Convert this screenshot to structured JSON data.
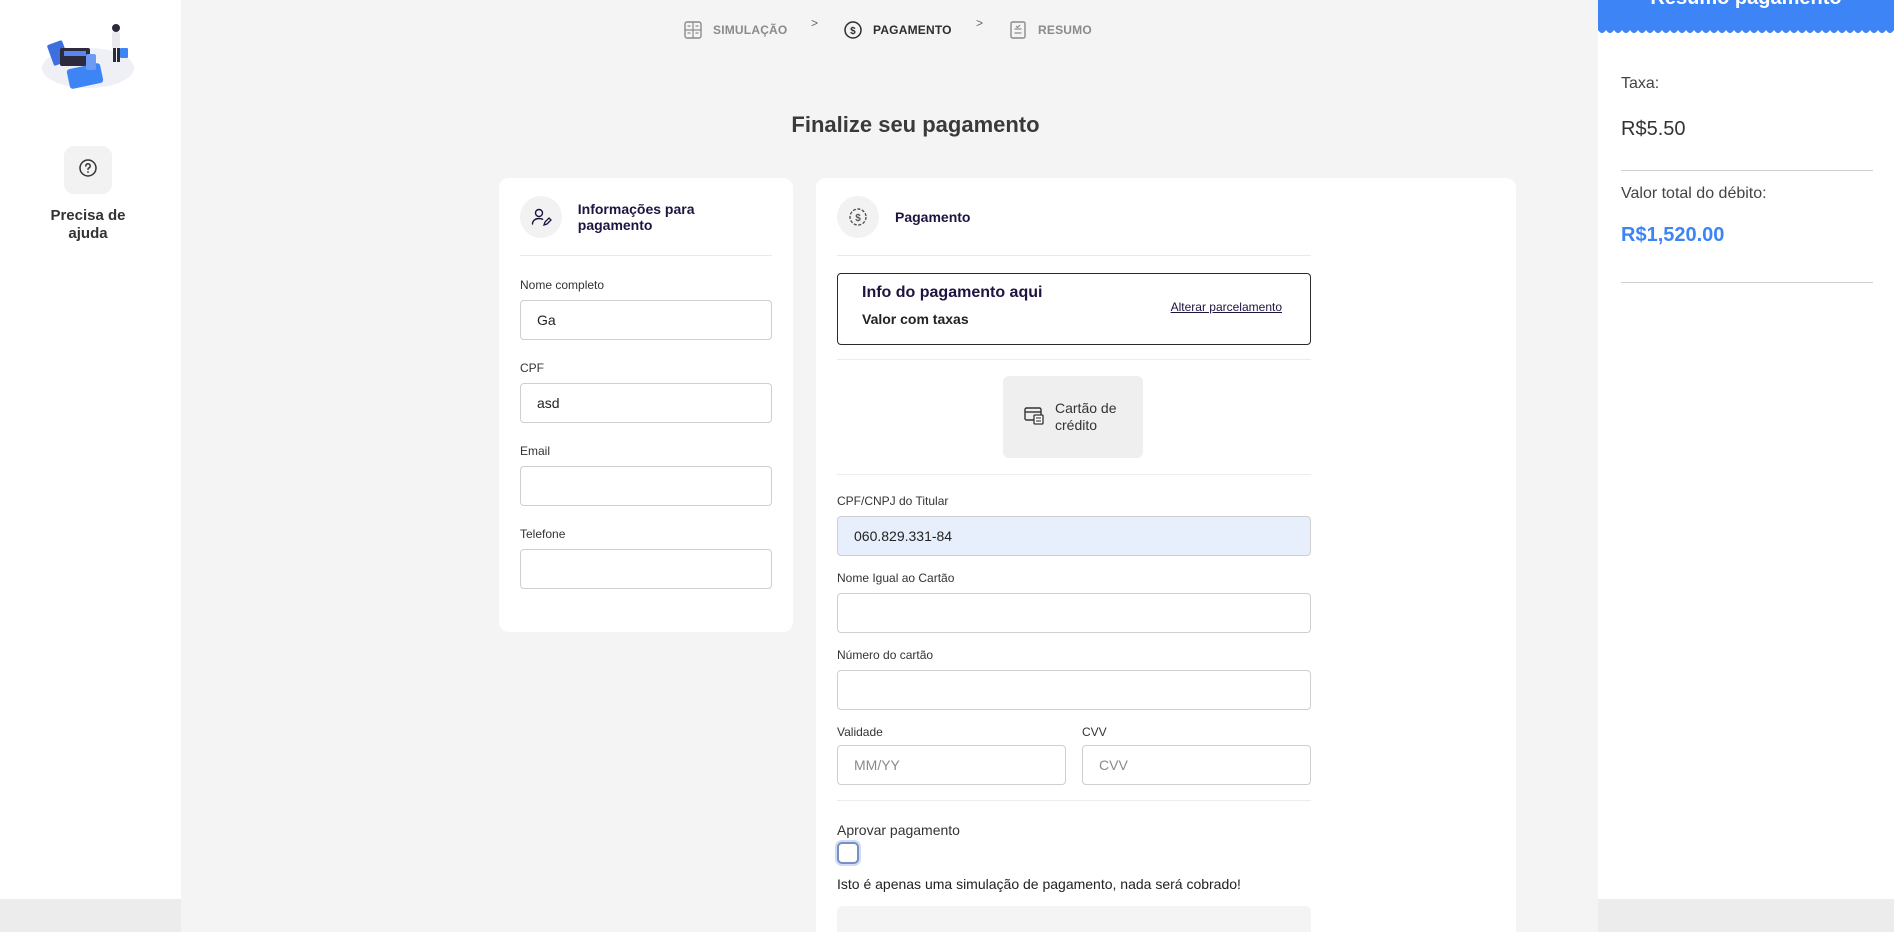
{
  "sidebar": {
    "help_label": "Precisa de ajuda"
  },
  "steps": [
    {
      "label": "SIMULAÇÃO",
      "state": "inactive"
    },
    {
      "label": "PAGAMENTO",
      "state": "active"
    },
    {
      "label": "RESUMO",
      "state": "inactive"
    }
  ],
  "step_separator": ">",
  "page_title": "Finalize seu pagamento",
  "info_card": {
    "title": "Informações para pagamento",
    "fields": [
      {
        "label": "Nome completo",
        "value": "Ga",
        "placeholder": ""
      },
      {
        "label": "CPF",
        "value": "asd",
        "placeholder": ""
      },
      {
        "label": "Email",
        "value": "",
        "placeholder": ""
      },
      {
        "label": "Telefone",
        "value": "",
        "placeholder": ""
      }
    ]
  },
  "payment_card": {
    "title": "Pagamento",
    "info_box": {
      "title": "Info do pagamento aqui",
      "subtitle": "Valor com taxas",
      "link": "Alterar parcelamento"
    },
    "method_button": "Cartão de crédito",
    "holder_doc": {
      "label": "CPF/CNPJ do Titular",
      "value": "060.829.331-84"
    },
    "card_name": {
      "label": "Nome Igual ao Cartão",
      "value": ""
    },
    "card_number": {
      "label": "Número do cartão",
      "value": ""
    },
    "expiry": {
      "label": "Validade",
      "placeholder": "MM/YY"
    },
    "cvv": {
      "label": "CVV",
      "placeholder": "CVV"
    },
    "approve_label": "Aprovar pagamento",
    "approve_checked": false,
    "disclaimer": "Isto é apenas uma simulação de pagamento, nada será cobrado!"
  },
  "summary": {
    "header": "Resumo pagamento",
    "tax_label": "Taxa:",
    "tax_value": "R$5.50",
    "total_label": "Valor total do débito:",
    "total_value": "R$1,520.00",
    "accent_color": "#3d84f7"
  }
}
